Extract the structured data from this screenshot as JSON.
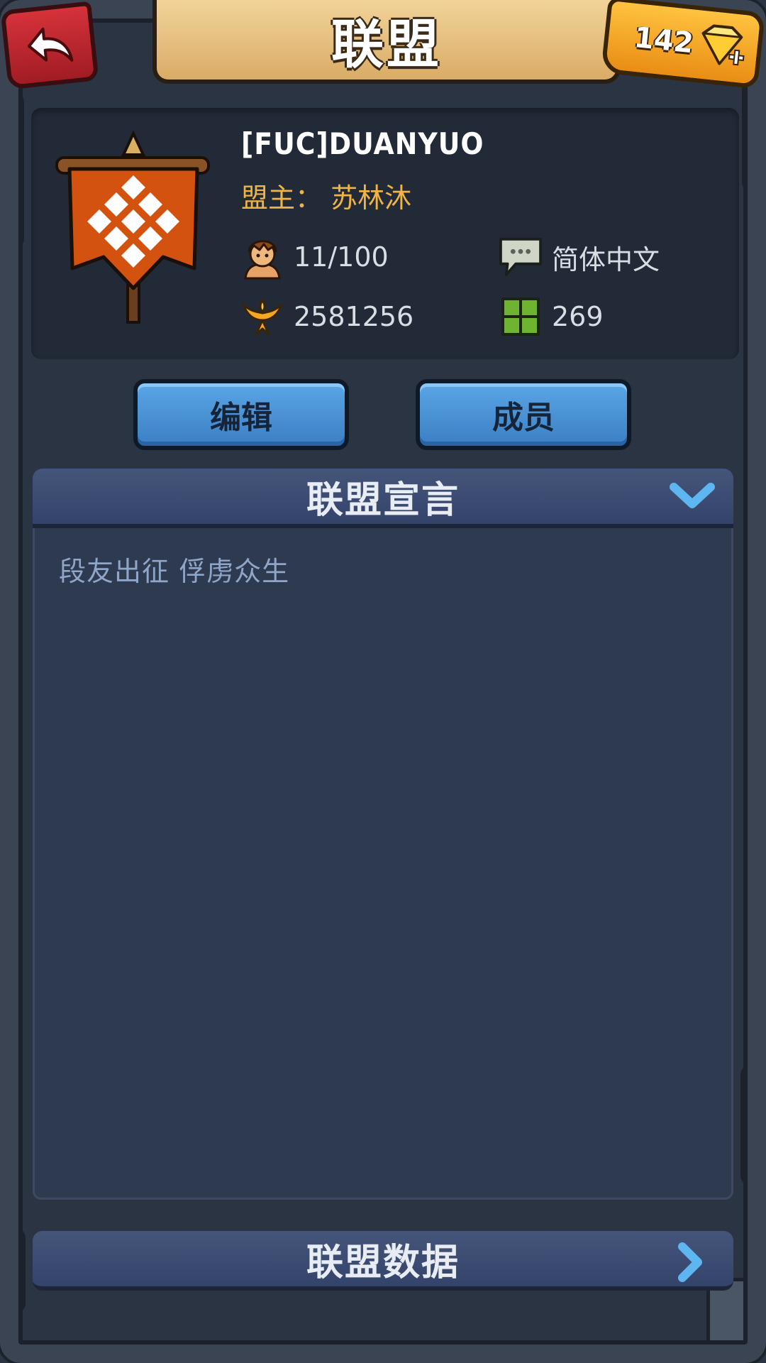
{
  "header": {
    "title": "联盟",
    "gems": "142"
  },
  "alliance": {
    "name": "[FUC]DUANYUO",
    "leader_label": "盟主：",
    "leader_name": "苏林沐",
    "members": "11/100",
    "language": "简体中文",
    "power": "2581256",
    "territory": "269"
  },
  "actions": {
    "edit_label": "编辑",
    "members_label": "成员"
  },
  "manifesto": {
    "title": "联盟宣言",
    "text": "段友出征  俘虏众生"
  },
  "stats_section": {
    "title": "联盟数据"
  },
  "colors": {
    "accent_gold": "#f0b444",
    "button_blue": "#4a92d6",
    "banner_red": "#d4520f",
    "territory_green": "#5fa02a"
  }
}
